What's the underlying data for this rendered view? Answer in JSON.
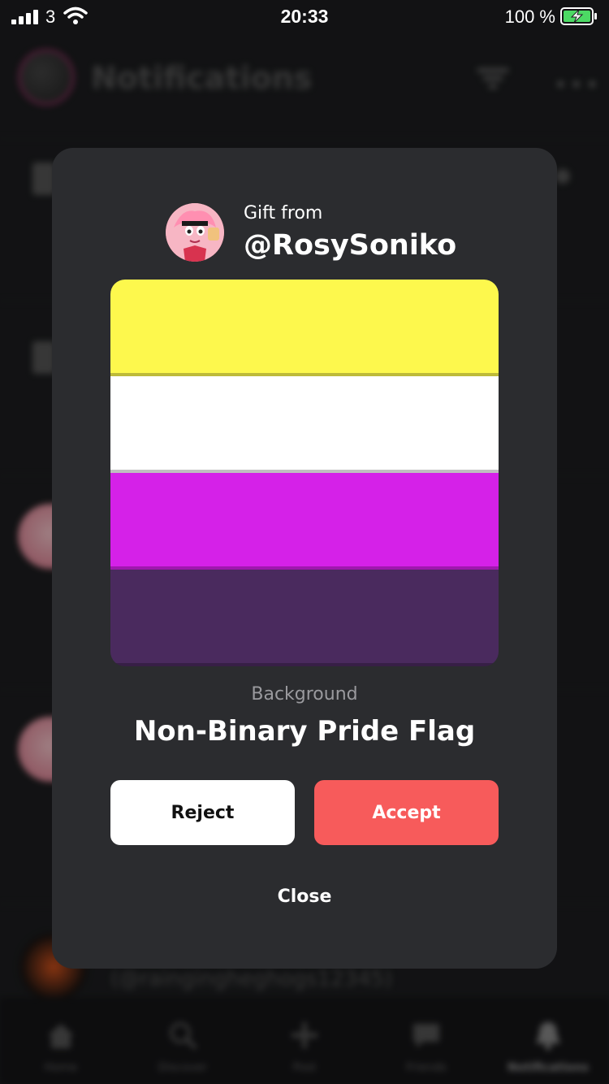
{
  "status_bar": {
    "carrier": "3",
    "time": "20:33",
    "battery": "100 %"
  },
  "background_app": {
    "title": "Notifications",
    "handle_text": "(@raingingheghogs12345)",
    "tabs": [
      {
        "label": "Home",
        "icon": "home-icon"
      },
      {
        "label": "Discover",
        "icon": "search-icon"
      },
      {
        "label": "Post",
        "icon": "plus-icon"
      },
      {
        "label": "Friends",
        "icon": "chat-icon"
      },
      {
        "label": "Notifications",
        "icon": "bell-icon"
      }
    ]
  },
  "gift_modal": {
    "from_label": "Gift from",
    "sender": "@RosySoniko",
    "item_type": "Background",
    "item_name": "Non-Binary Pride Flag",
    "flag_colors": [
      "#fdf84d",
      "#ffffff",
      "#d521e8",
      "#4a2a5e"
    ],
    "reject_label": "Reject",
    "accept_label": "Accept",
    "close_label": "Close",
    "accent_color": "#f75b5b"
  }
}
